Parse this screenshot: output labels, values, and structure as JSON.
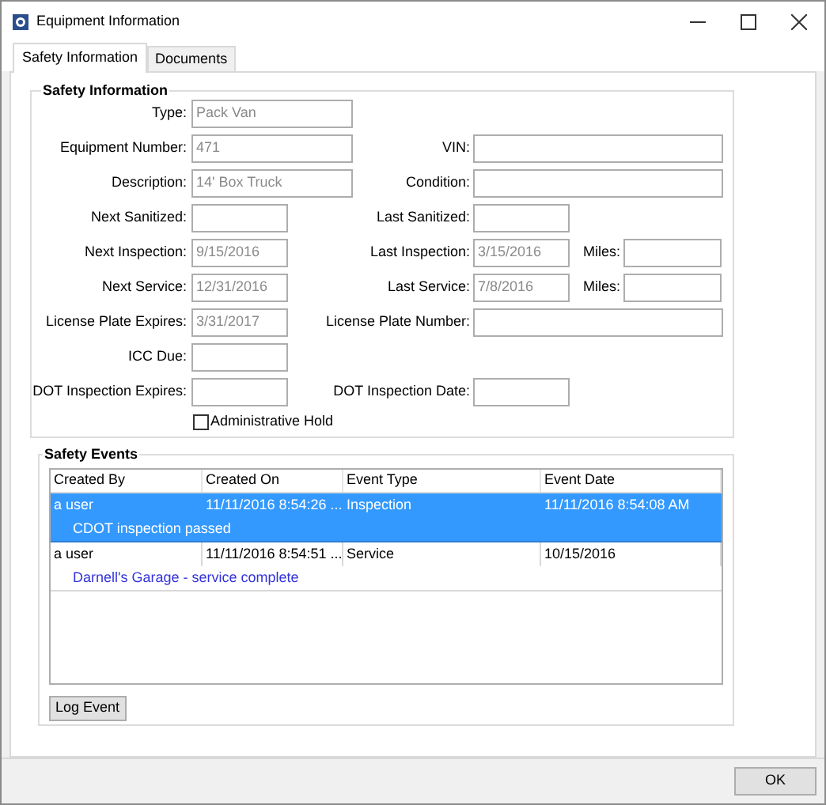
{
  "window": {
    "title": "Equipment Information"
  },
  "tabs": [
    {
      "label": "Safety Information",
      "selected": true
    },
    {
      "label": "Documents",
      "selected": false
    }
  ],
  "safety_information": {
    "title": "Safety Information",
    "rows": [
      {
        "left": {
          "label": "Type:",
          "value": "Pack Van",
          "kind": "wide"
        }
      },
      {
        "left": {
          "label": "Equipment Number:",
          "value": "471",
          "kind": "wide"
        },
        "right": {
          "label": "VIN:",
          "kind": "wide"
        }
      },
      {
        "left": {
          "label": "Description:",
          "value": "14' Box Truck",
          "kind": "wide"
        },
        "right": {
          "label": "Condition:",
          "kind": "wide"
        }
      },
      {
        "left": {
          "label": "Next Sanitized:",
          "kind": "short"
        },
        "right": {
          "label": "Last Sanitized:",
          "kind": "short"
        }
      },
      {
        "left": {
          "label": "Next Inspection:",
          "value": "9/15/2016",
          "kind": "short"
        },
        "right": {
          "label": "Last Inspection:",
          "value": "3/15/2016",
          "kind": "short"
        },
        "miles": {
          "label": "Miles:"
        }
      },
      {
        "left": {
          "label": "Next Service:",
          "value": "12/31/2016",
          "kind": "short"
        },
        "right": {
          "label": "Last Service:",
          "value": "7/8/2016",
          "kind": "short"
        },
        "miles": {
          "label": "Miles:"
        }
      },
      {
        "left": {
          "label": "License Plate Expires:",
          "value": "3/31/2017",
          "kind": "short"
        },
        "right": {
          "label": "License Plate Number:",
          "kind": "wide"
        }
      },
      {
        "left": {
          "label": "ICC Due:",
          "kind": "short"
        }
      },
      {
        "left": {
          "label": "DOT Inspection Expires:",
          "kind": "short"
        },
        "right": {
          "label": "DOT Inspection Date:",
          "kind": "short"
        }
      }
    ],
    "administrative_hold": {
      "label": "Administrative Hold",
      "checked": false
    }
  },
  "safety_events": {
    "title": "Safety Events",
    "columns": [
      "Created By",
      "Created On",
      "Event Type",
      "Event Date"
    ],
    "rows": [
      {
        "cells": [
          "a user",
          "11/11/2016 8:54:26 ...",
          "Inspection",
          "11/11/2016 8:54:08 AM"
        ],
        "note": "CDOT inspection passed",
        "selected": true
      },
      {
        "cells": [
          "a user",
          "11/11/2016 8:54:51 ...",
          "Service",
          "10/15/2016"
        ],
        "note": "Darnell's Garage - service complete",
        "selected": false
      }
    ],
    "log_button": "Log Event"
  },
  "ok_button": "OK"
}
